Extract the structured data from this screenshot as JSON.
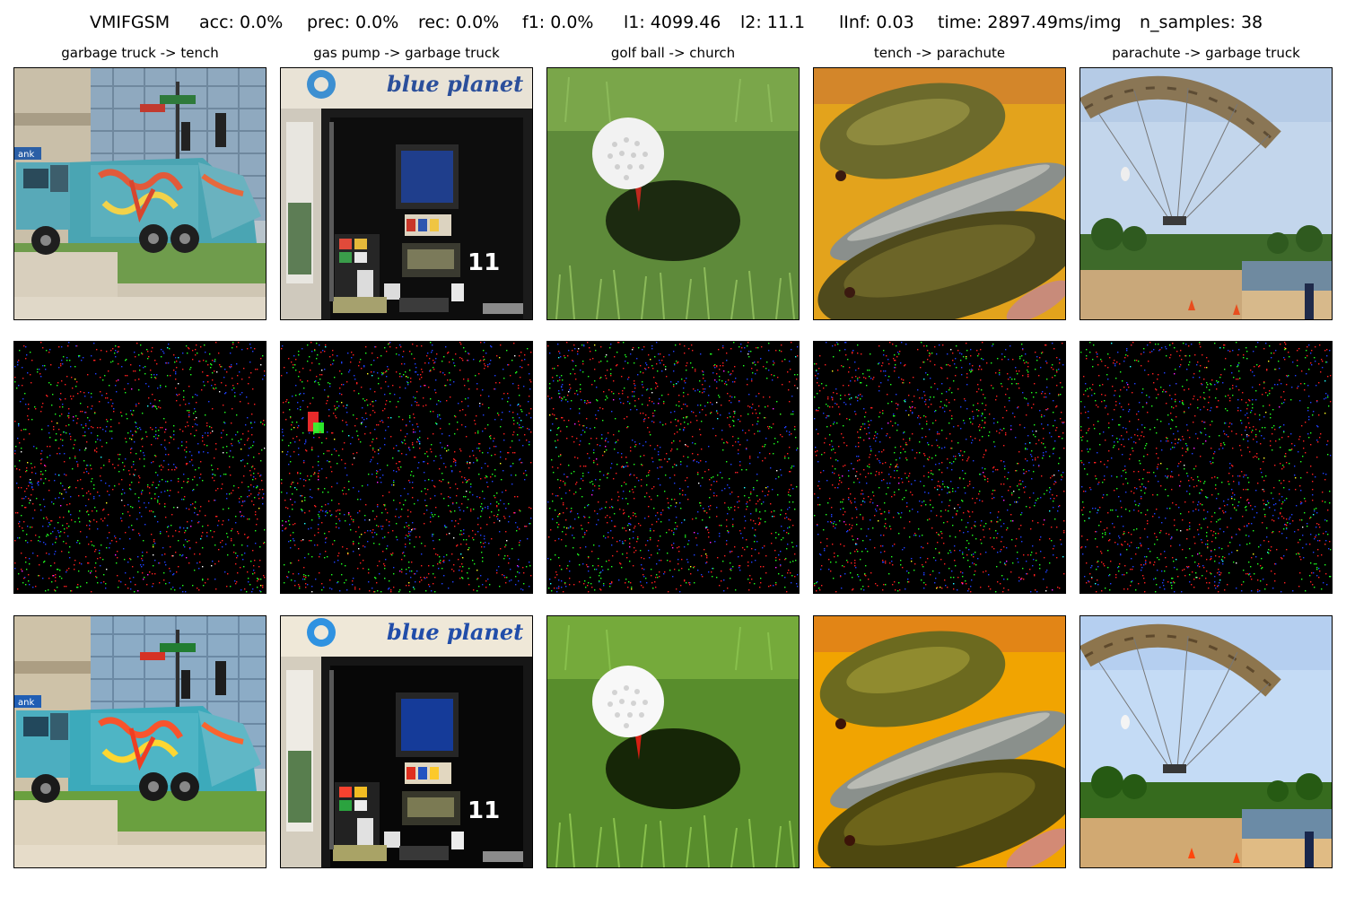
{
  "figure": {
    "header": {
      "method": "VMIFGSM",
      "acc": "acc: 0.0%",
      "prec": "prec: 0.0%",
      "rec": "rec: 0.0%",
      "f1": "f1: 0.0%",
      "l1": "l1: 4099.46",
      "l2": "l2: 11.1",
      "linf": "lInf: 0.03",
      "time": "time: 2897.49ms/img",
      "n_samples": "n_samples: 38"
    },
    "columns": [
      {
        "title": "garbage truck -> tench",
        "scene": "garbage-truck"
      },
      {
        "title": "gas pump -> garbage truck",
        "scene": "gas-pump",
        "sign_text": "blue planet",
        "pump_number": "11"
      },
      {
        "title": "golf ball -> church",
        "scene": "golf-ball"
      },
      {
        "title": "tench -> parachute",
        "scene": "tench"
      },
      {
        "title": "parachute -> garbage truck",
        "scene": "parachute"
      }
    ],
    "rows": [
      "original",
      "perturbation",
      "adversarial"
    ],
    "noise_colors": [
      "#ff2020",
      "#20ff20",
      "#2040ff",
      "#ffffff",
      "#ff20ff",
      "#20ffff",
      "#ffff20"
    ]
  }
}
